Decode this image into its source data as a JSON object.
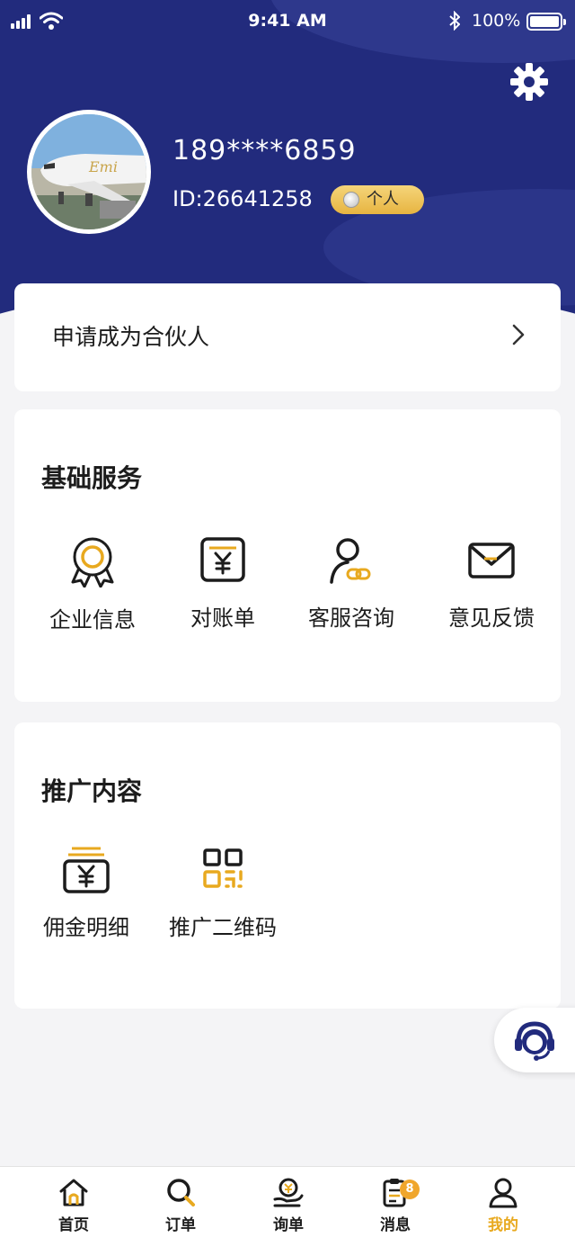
{
  "status_bar": {
    "time": "9:41 AM",
    "battery": "100%",
    "icons": [
      "signal-icon",
      "wifi-icon",
      "bluetooth-icon",
      "battery-icon"
    ]
  },
  "profile": {
    "phone": "189****6859",
    "user_id": "ID:26641258",
    "account_type": "个人"
  },
  "partner": {
    "label": "申请成为合伙人"
  },
  "basic_services": {
    "title": "基础服务",
    "items": [
      {
        "label": "企业信息",
        "icon": "award-badge-icon"
      },
      {
        "label": "对账单",
        "icon": "statement-icon"
      },
      {
        "label": "客服咨询",
        "icon": "customer-service-icon"
      },
      {
        "label": "意见反馈",
        "icon": "mail-icon"
      }
    ]
  },
  "promotion": {
    "title": "推广内容",
    "items": [
      {
        "label": "佣金明细",
        "icon": "commission-icon"
      },
      {
        "label": "推广二维码",
        "icon": "qr-code-icon"
      }
    ]
  },
  "tabbar": {
    "items": [
      {
        "label": "首页",
        "icon": "home-icon"
      },
      {
        "label": "订单",
        "icon": "search-icon"
      },
      {
        "label": "询单",
        "icon": "inquiry-icon"
      },
      {
        "label": "消息",
        "icon": "message-icon",
        "badge": "8"
      },
      {
        "label": "我的",
        "icon": "user-icon",
        "active": true
      }
    ]
  },
  "colors": {
    "header_bg": "#222b7d",
    "accent": "#e8a91f",
    "icon_dark": "#1c1c1c",
    "page_bg": "#f4f4f6"
  }
}
